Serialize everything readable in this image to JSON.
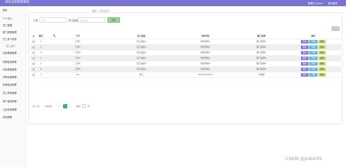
{
  "app": {
    "title": "ZKK仓库管理系统",
    "user": "管理员 admin",
    "logout": "退出登录"
  },
  "sidebar": {
    "items": [
      {
        "label": "首页",
        "sub": false
      },
      {
        "label": "个人中心",
        "sub": false
      },
      {
        "label": "员工管理",
        "sub": false
      },
      {
        "label": "部门类型管理",
        "sub": false
      },
      {
        "label": "员工部门管理",
        "sub": false
      },
      {
        "label": "员工部门",
        "sub": true
      },
      {
        "label": "仓库类型管理",
        "sub": false
      },
      {
        "label": "货物信息管理",
        "sub": false
      },
      {
        "label": "仓库类型管理",
        "sub": false
      },
      {
        "label": "货物出库管理",
        "sub": false
      },
      {
        "label": "存储地点管理",
        "sub": false
      },
      {
        "label": "员工考勤管理",
        "sub": false
      },
      {
        "label": "用户留言管理",
        "sub": false
      },
      {
        "label": "公告信息管理",
        "sub": false
      },
      {
        "label": "系统管理",
        "sub": false
      }
    ]
  },
  "breadcrumb": {
    "home": "首页",
    "current": "员工部门"
  },
  "search": {
    "label1": "工号",
    "placeholder1": "工号",
    "label2": "员工姓名",
    "placeholder2": "员工姓名",
    "button": "查询"
  },
  "table": {
    "headers": [
      "索引",
      "工号",
      "员工姓名",
      "手机号码",
      "部门名称",
      "操作"
    ],
    "rows": [
      {
        "index": "1",
        "work_no": "工号1",
        "name": "员工姓名1",
        "phone": "手机号码1",
        "dept": "部门名称1"
      },
      {
        "index": "2",
        "work_no": "工号2",
        "name": "员工姓名2",
        "phone": "手机号码2",
        "dept": "部门名称2"
      },
      {
        "index": "3",
        "work_no": "工号3",
        "name": "员工姓名3",
        "phone": "手机号码3",
        "dept": "部门名称3"
      },
      {
        "index": "4",
        "work_no": "工号4",
        "name": "员工姓名4",
        "phone": "手机号码4",
        "dept": "部门名称4"
      },
      {
        "index": "5",
        "work_no": "工号5",
        "name": "员工姓名5",
        "phone": "手机号码5",
        "dept": "部门名称5"
      },
      {
        "index": "6",
        "work_no": "工号6",
        "name": "员工姓名6",
        "phone": "手机号码6",
        "dept": "部门名称6"
      },
      {
        "index": "7",
        "work_no": "111",
        "name": "张三",
        "phone": "15333333333",
        "dept": "行政部"
      }
    ],
    "actions": {
      "edit": "修改",
      "view": "详情",
      "del": "删除"
    }
  },
  "pager": {
    "total": "共 7 条",
    "size": "10条/页",
    "prev": "<",
    "page": "1",
    "next": ">",
    "goto": "前往",
    "unit": "页"
  },
  "watermark": "CSDN @jinkin05"
}
